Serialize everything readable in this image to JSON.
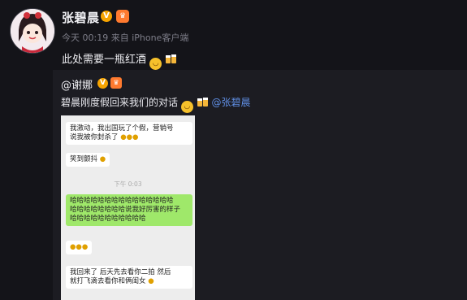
{
  "post": {
    "author": "张碧晨",
    "verified_icon": "verified-v-icon",
    "vip_icon": "vip-crown-icon",
    "timestamp": "今天 00:19",
    "source": "来自 iPhone客户端",
    "text": "此处需要一瓶红酒"
  },
  "repost": {
    "author": "@谢娜",
    "text_prefix": "碧晨刚度假回来我们的对话",
    "mention": "@张碧晨"
  },
  "chat": {
    "msg1_line1": "我激动，我出国玩了个假，营销号",
    "msg1_line2": "说我被你封杀了",
    "msg2": "笑到颤抖",
    "time": "下午 0:03",
    "msg3_line1": "哈哈哈哈哈哈哈哈哈哈哈哈哈哈哈",
    "msg3_line2": "哈哈哈哈哈哈哈哈说我好厉害的样子",
    "msg3_line3": "哈哈哈哈哈哈哈哈哈哈哈",
    "msg5_line1": "我回来了 后天先去看你二拍 然后",
    "msg5_line2": "就打飞滴去看你和俩闺女"
  },
  "colors": {
    "background": "#141419",
    "repost_background": "#1c1c22",
    "mention": "#5f8ee3",
    "verified": "#f7a400",
    "chat_green": "#9fe86a"
  }
}
